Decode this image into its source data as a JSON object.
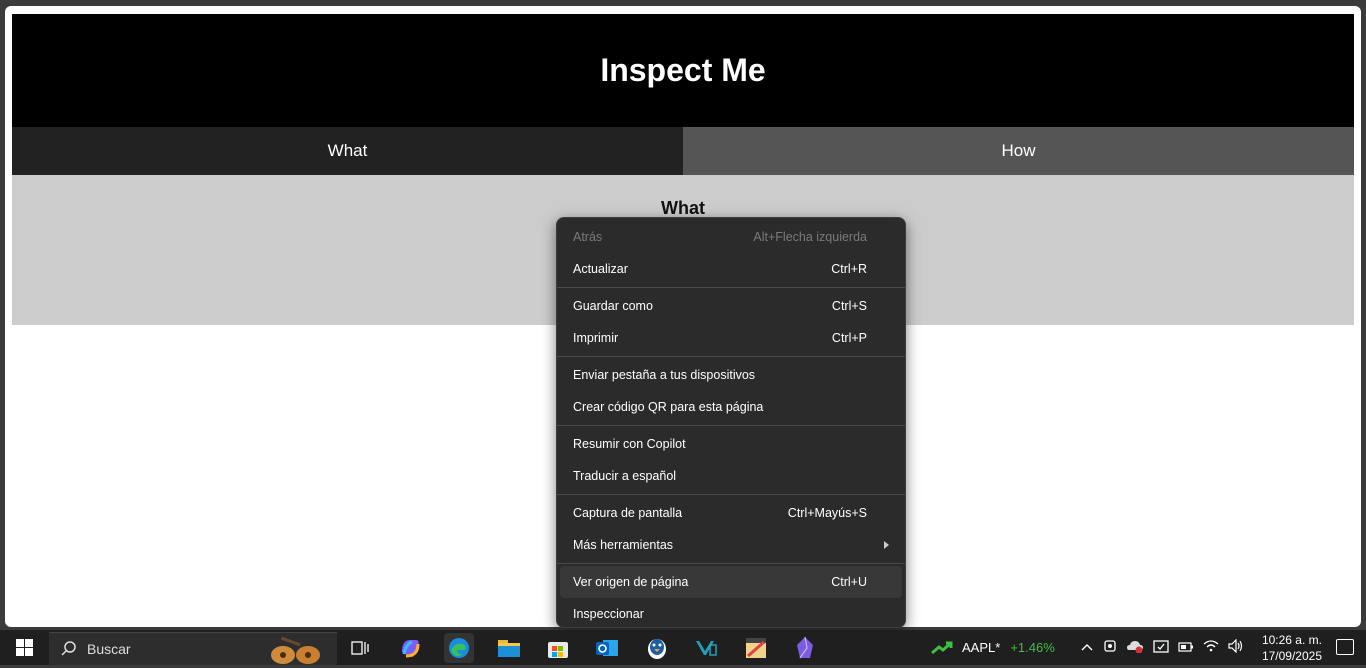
{
  "page": {
    "title": "Inspect Me",
    "tabs": [
      {
        "label": "What"
      },
      {
        "label": "How"
      }
    ],
    "section_heading": "What"
  },
  "context_menu": {
    "items": [
      {
        "label": "Atrás",
        "shortcut": "Alt+Flecha izquierda"
      },
      {
        "label": "Actualizar",
        "shortcut": "Ctrl+R"
      },
      {
        "label": "Guardar como",
        "shortcut": "Ctrl+S"
      },
      {
        "label": "Imprimir",
        "shortcut": "Ctrl+P"
      },
      {
        "label": "Enviar pestaña a tus dispositivos",
        "shortcut": ""
      },
      {
        "label": "Crear código QR para esta página",
        "shortcut": ""
      },
      {
        "label": "Resumir con Copilot",
        "shortcut": ""
      },
      {
        "label": "Traducir a español",
        "shortcut": ""
      },
      {
        "label": "Captura de pantalla",
        "shortcut": "Ctrl+Mayús+S"
      },
      {
        "label": "Más herramientas",
        "shortcut": ""
      },
      {
        "label": "Ver origen de página",
        "shortcut": "Ctrl+U"
      },
      {
        "label": "Inspeccionar",
        "shortcut": ""
      }
    ]
  },
  "taskbar": {
    "search_placeholder": "Buscar",
    "stock_ticker": "AAPL*",
    "stock_change": "+1.46%",
    "time": "10:26 a. m.",
    "date": "17/09/2025",
    "icons": [
      "windows-start-icon",
      "search-icon",
      "task-view-icon",
      "copilot-icon",
      "edge-icon",
      "file-explorer-icon",
      "store-icon",
      "outlook-icon",
      "penguin-app-icon",
      "visual-studio-icon",
      "git-bash-icon",
      "obsidian-icon"
    ],
    "colors": {
      "stock_up": "#3fbf3f",
      "accent": "#0078d4"
    }
  }
}
